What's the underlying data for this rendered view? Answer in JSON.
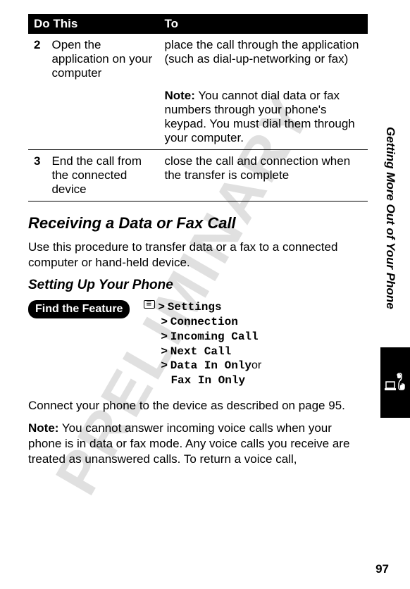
{
  "watermark": "PRELIMINARY",
  "side_title": "Getting More Out of Your Phone",
  "page_number": "97",
  "table": {
    "headers": {
      "do_this": "Do This",
      "to": "To"
    },
    "rows": [
      {
        "num": "2",
        "do": "Open the application on your computer",
        "to": "place the call through the application (such as dial-up-networking or fax)",
        "note_prefix": "Note:",
        "note": " You cannot dial data or fax numbers through your phone's keypad. You must dial them through your computer."
      },
      {
        "num": "3",
        "do": "End the call from the connected device",
        "to": "close the call and connection when the transfer is complete"
      }
    ]
  },
  "section_title": "Receiving a Data or Fax Call",
  "intro_text": "Use this procedure to transfer data or a fax to a connected computer or hand-held device.",
  "subsection_title": "Setting Up Your Phone",
  "find_feature": {
    "label": "Find the Feature",
    "lines": [
      "Settings",
      "Connection",
      "Incoming Call",
      "Next Call",
      "Data In Only",
      "Fax In Only"
    ],
    "or": " or"
  },
  "connect_text": "Connect your phone to the device as described on page 95.",
  "note2_prefix": "Note:",
  "note2_text": " You cannot answer incoming voice calls when your phone is in data or fax mode. Any voice calls you receive are treated as unanswered calls. To return a voice call,"
}
